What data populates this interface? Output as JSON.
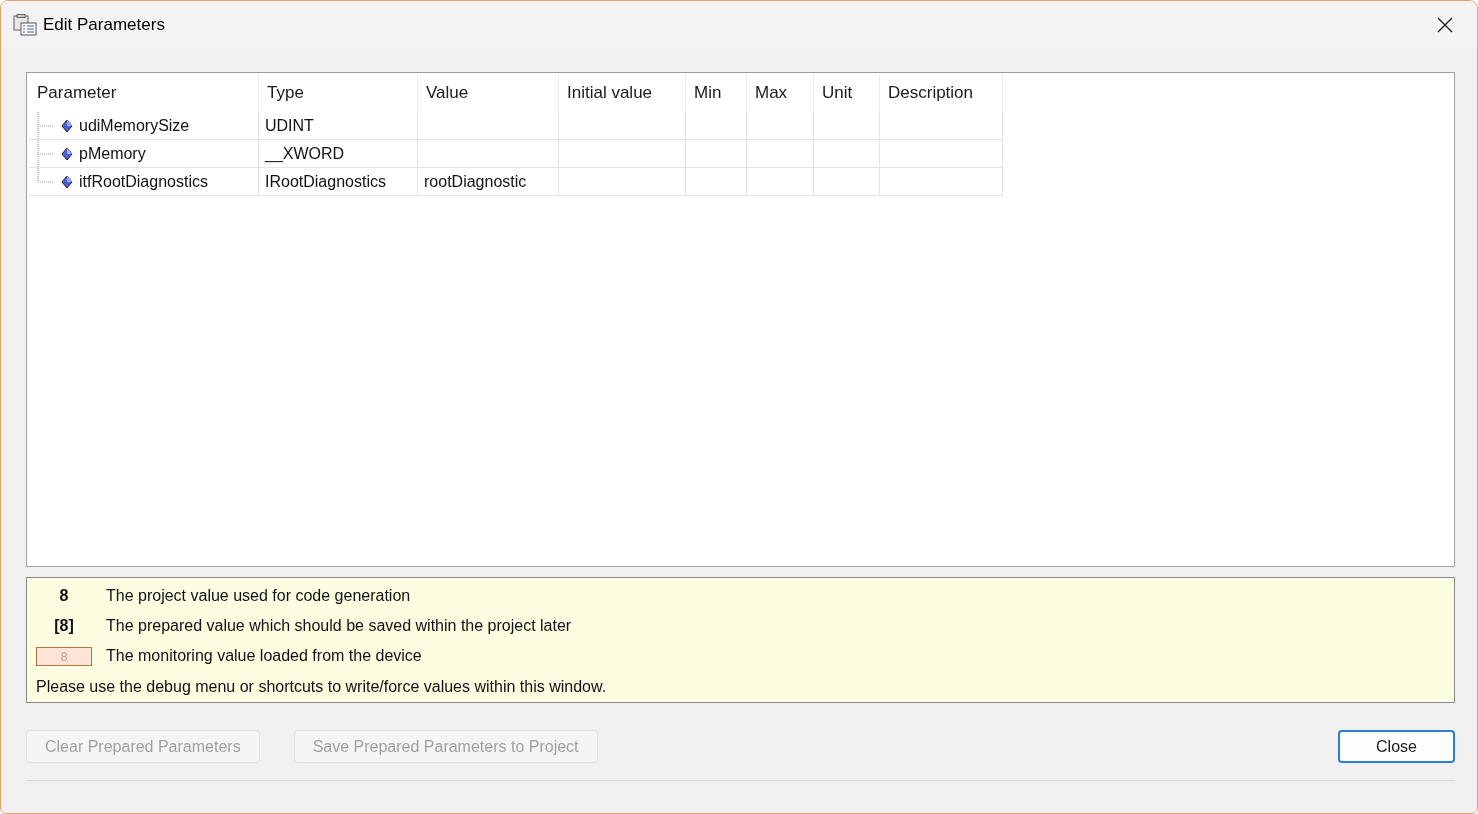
{
  "window": {
    "title": "Edit Parameters"
  },
  "table": {
    "columns": [
      "Parameter",
      "Type",
      "Value",
      "Initial value",
      "Min",
      "Max",
      "Unit",
      "Description"
    ],
    "rows": [
      {
        "parameter": "udiMemorySize",
        "type": "UDINT"
      },
      {
        "parameter": "pMemory",
        "type": "__XWORD"
      },
      {
        "parameter": "itfRootDiagnostics",
        "type": "IRootDiagnostics",
        "value": "rootDiagnostic"
      }
    ]
  },
  "legend": {
    "items": [
      {
        "kind": "project",
        "sample": "8",
        "text": "The project value used for code generation"
      },
      {
        "kind": "prepared",
        "sample": "[8]",
        "text": "The prepared value which should be saved within the project later"
      },
      {
        "kind": "monitoring",
        "sample": "8",
        "text": "The monitoring value loaded from the device"
      }
    ],
    "note": "Please use the debug menu or shortcuts to write/force values within this window."
  },
  "buttons": [
    {
      "label": "Clear Prepared Parameters",
      "disabled": true,
      "default": false
    },
    {
      "label": "Save Prepared Parameters to Project",
      "disabled": true,
      "default": false
    },
    {
      "label": "Close",
      "disabled": false,
      "default": true
    }
  ]
}
